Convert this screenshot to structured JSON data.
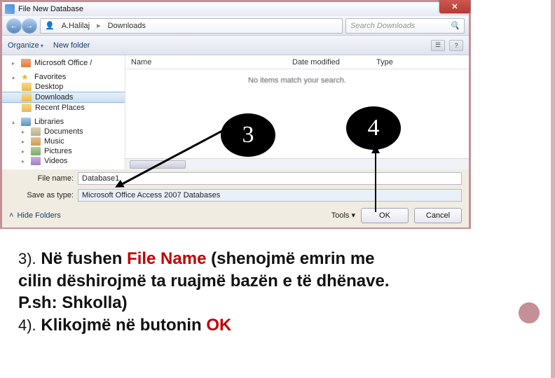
{
  "dialog": {
    "title": "File New Database",
    "path": {
      "seg1": "A.Halilaj",
      "seg2": "Downloads"
    },
    "search_placeholder": "Search Downloads",
    "toolbar": {
      "organize": "Organize",
      "new_folder": "New folder"
    },
    "sidebar": {
      "office": "Microsoft Office /",
      "favorites": "Favorites",
      "desktop": "Desktop",
      "downloads": "Downloads",
      "recent": "Recent Places",
      "libraries": "Libraries",
      "documents": "Documents",
      "music": "Music",
      "pictures": "Pictures",
      "videos": "Videos"
    },
    "columns": {
      "name": "Name",
      "date": "Date modified",
      "type": "Type"
    },
    "empty_msg": "No items match your search.",
    "file_name_label": "File name:",
    "file_name_value": "Database1",
    "save_type_label": "Save as type:",
    "save_type_value": "Microsoft Office Access 2007 Databases",
    "hide_folders": "Hide Folders",
    "tools": "Tools",
    "ok": "OK",
    "cancel": "Cancel"
  },
  "annot": {
    "three": "3",
    "four": "4"
  },
  "text": {
    "l1a": "3).",
    "l1b": "Në fushen",
    "l1c": "File Name",
    "l1d": "(shenojmë emrin me",
    "l2": "cilin dëshirojmë ta ruajmë bazën e të dhënave.",
    "l3": "P.sh: Shkolla)",
    "l4a": "4).",
    "l4b": "Klikojmë në butonin",
    "l4c": "OK"
  }
}
